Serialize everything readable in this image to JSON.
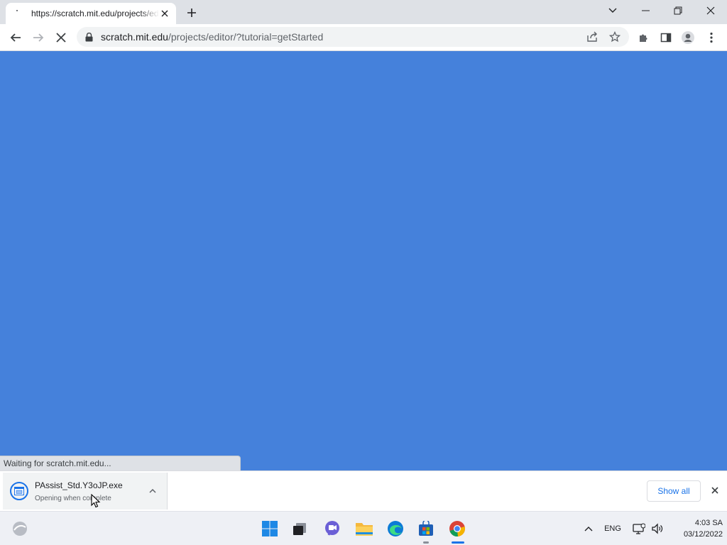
{
  "browser": {
    "tab": {
      "title": "https://scratch.mit.edu/projects/editor/?tutorial=getStarted"
    },
    "address": {
      "host": "scratch.mit.edu",
      "path": "/projects/editor/?tutorial=getStarted"
    },
    "status_text": "Waiting for scratch.mit.edu..."
  },
  "download": {
    "filename": "PAssist_Std.Y3oJP.exe",
    "status": "Opening when complete",
    "show_all_label": "Show all"
  },
  "taskbar": {
    "language": "ENG",
    "time": "4:03 SA",
    "date": "03/12/2022"
  },
  "colors": {
    "page_background": "#4581db",
    "accent": "#1a73e8"
  }
}
